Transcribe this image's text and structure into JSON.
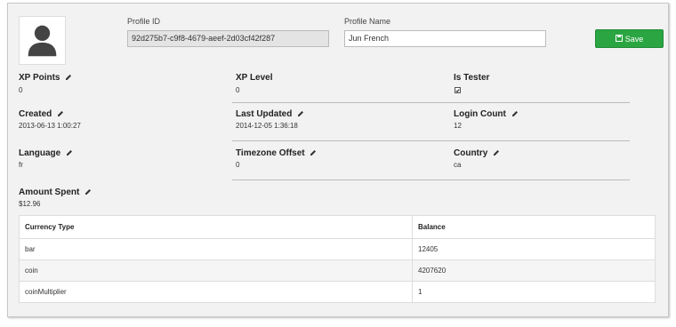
{
  "profile": {
    "id_label": "Profile ID",
    "id_value": "92d275b7-c9f8-4679-aeef-2d03cf42f287",
    "name_label": "Profile Name",
    "name_value": "Jun French",
    "save_label": "Save"
  },
  "stats": {
    "xp_points": {
      "label": "XP Points",
      "value": "0"
    },
    "xp_level": {
      "label": "XP Level",
      "value": "0"
    },
    "is_tester": {
      "label": "Is Tester",
      "checked": true
    },
    "created": {
      "label": "Created",
      "value": "2013-06-13 1:00:27"
    },
    "last_updated": {
      "label": "Last Updated",
      "value": "2014-12-05 1:36:18"
    },
    "login_count": {
      "label": "Login Count",
      "value": "12"
    },
    "language": {
      "label": "Language",
      "value": "fr"
    },
    "timezone_offset": {
      "label": "Timezone Offset",
      "value": "0"
    },
    "country": {
      "label": "Country",
      "value": "ca"
    },
    "amount_spent": {
      "label": "Amount Spent",
      "value": "$12.96"
    }
  },
  "currency_table": {
    "headers": [
      "Currency Type",
      "Balance"
    ],
    "rows": [
      [
        "bar",
        "12405"
      ],
      [
        "coin",
        "4207620"
      ],
      [
        "coinMultiplier",
        "1"
      ]
    ]
  },
  "colors": {
    "save_button": "#2aa542",
    "panel_bg": "#f2f2f2"
  }
}
